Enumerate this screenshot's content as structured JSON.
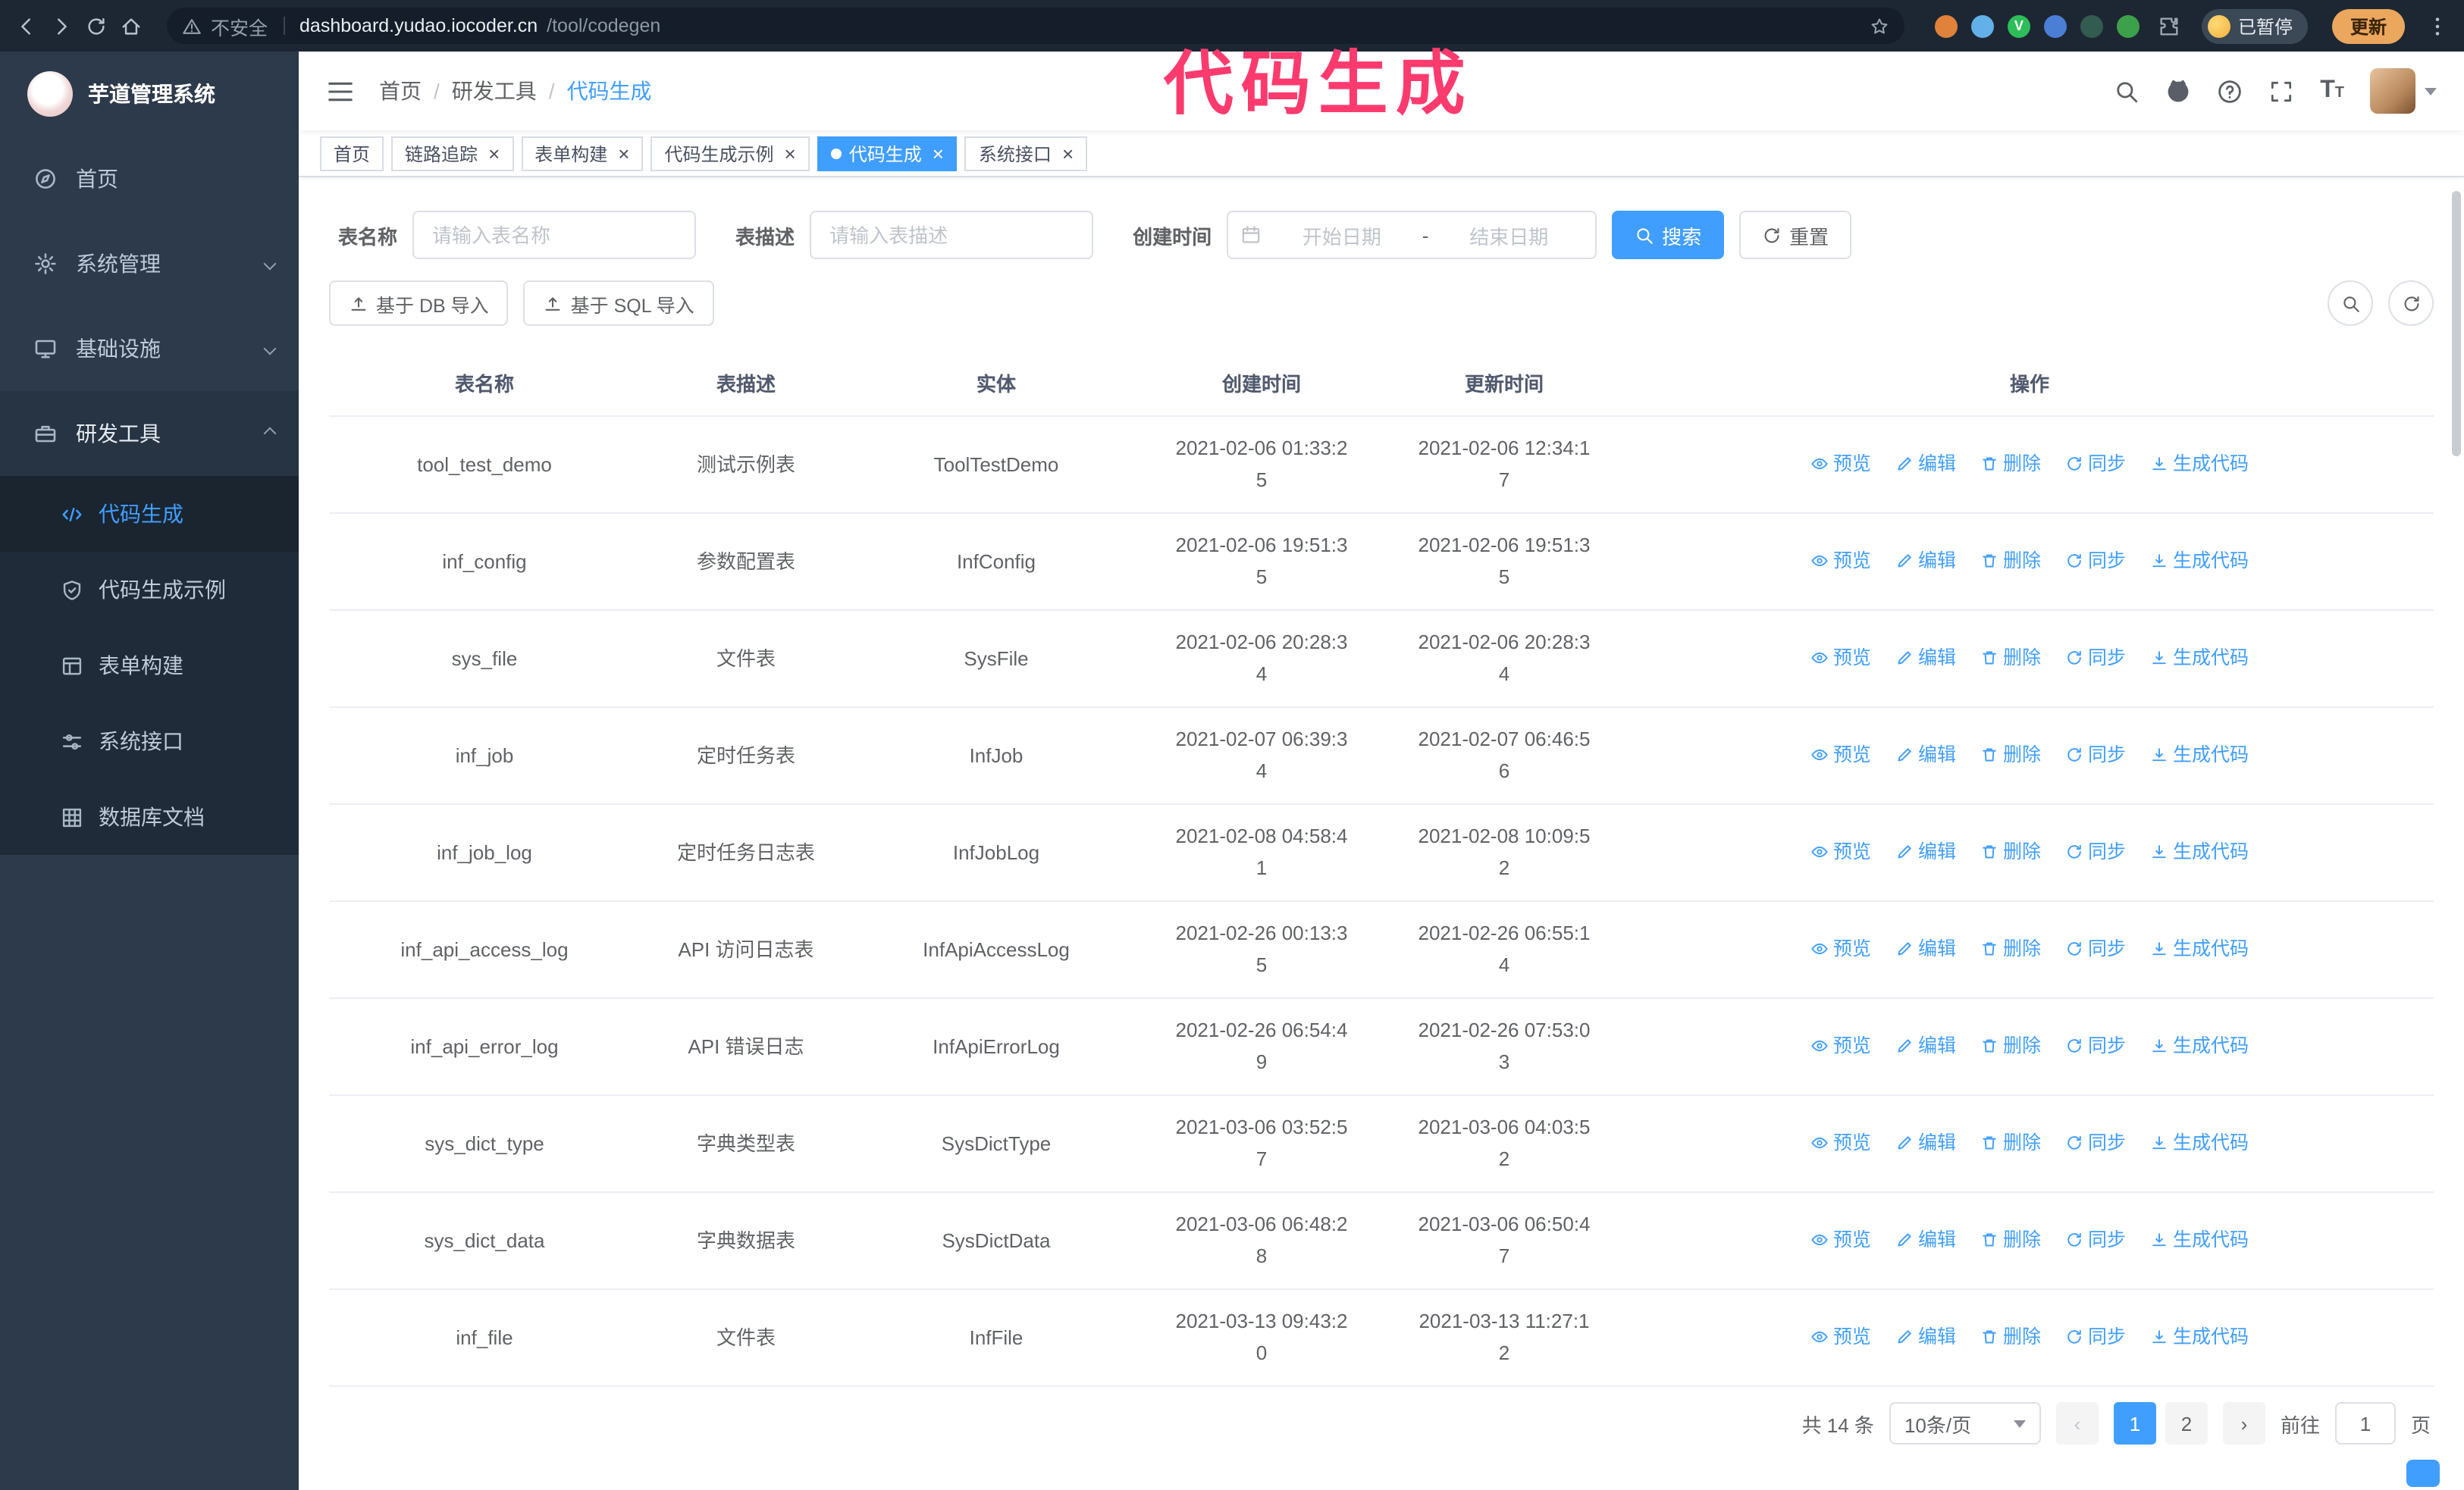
{
  "colors": {
    "accent": "#409eff",
    "annotation_pink": "#fb3b6e",
    "sidebar_bg": "#2d3a4b",
    "submenu_bg": "#1f2b38",
    "chrome_bg": "#1d2733",
    "update_button_bg": "#eba75d"
  },
  "annotation_text": "代码生成",
  "browser": {
    "security_text": "不安全",
    "url_host": "dashboard.yudao.iocoder.cn",
    "url_path": "/tool/codegen",
    "profile_badge": "已暂停",
    "update_button": "更新",
    "extension_colors": [
      "#e0823a",
      "#62b0e8",
      "#2ebd59",
      "#4b7fd6",
      "#315c4f",
      "#3da04a"
    ],
    "extension_glyph": "V"
  },
  "sidebar": {
    "logo_title": "芋道管理系统",
    "items": [
      {
        "label": "首页",
        "icon": "compass"
      },
      {
        "label": "系统管理",
        "icon": "gear",
        "chevron": "down"
      },
      {
        "label": "基础设施",
        "icon": "monitor",
        "chevron": "down"
      },
      {
        "label": "研发工具",
        "icon": "toolbox",
        "chevron": "up",
        "expanded": true
      }
    ],
    "sub_items": [
      {
        "label": "代码生成",
        "icon": "code",
        "active": true
      },
      {
        "label": "代码生成示例",
        "icon": "shield"
      },
      {
        "label": "表单构建",
        "icon": "form"
      },
      {
        "label": "系统接口",
        "icon": "sliders"
      },
      {
        "label": "数据库文档",
        "icon": "grid"
      }
    ]
  },
  "header": {
    "breadcrumb": [
      "首页",
      "研发工具",
      "代码生成"
    ]
  },
  "tabs": [
    {
      "label": "首页",
      "closable": false,
      "active": false
    },
    {
      "label": "链路追踪",
      "closable": true,
      "active": false
    },
    {
      "label": "表单构建",
      "closable": true,
      "active": false
    },
    {
      "label": "代码生成示例",
      "closable": true,
      "active": false
    },
    {
      "label": "代码生成",
      "closable": true,
      "active": true
    },
    {
      "label": "系统接口",
      "closable": true,
      "active": false
    }
  ],
  "filters": {
    "table_name_label": "表名称",
    "table_name_placeholder": "请输入表名称",
    "table_desc_label": "表描述",
    "table_desc_placeholder": "请输入表描述",
    "create_time_label": "创建时间",
    "date_start_placeholder": "开始日期",
    "date_separator": "-",
    "date_end_placeholder": "结束日期",
    "search_button": "搜索",
    "reset_button": "重置"
  },
  "toolbar": {
    "import_db": "基于 DB 导入",
    "import_sql": "基于 SQL 导入"
  },
  "table": {
    "columns": [
      "表名称",
      "表描述",
      "实体",
      "创建时间",
      "更新时间",
      "操作"
    ],
    "actions": [
      {
        "label": "预览",
        "icon": "eye"
      },
      {
        "label": "编辑",
        "icon": "edit"
      },
      {
        "label": "删除",
        "icon": "trash"
      },
      {
        "label": "同步",
        "icon": "sync"
      },
      {
        "label": "生成代码",
        "icon": "download"
      }
    ],
    "rows": [
      {
        "name": "tool_test_demo",
        "desc": "测试示例表",
        "entity": "ToolTestDemo",
        "created": "2021-02-06 01:33:25",
        "updated": "2021-02-06 12:34:17"
      },
      {
        "name": "inf_config",
        "desc": "参数配置表",
        "entity": "InfConfig",
        "created": "2021-02-06 19:51:35",
        "updated": "2021-02-06 19:51:35"
      },
      {
        "name": "sys_file",
        "desc": "文件表",
        "entity": "SysFile",
        "created": "2021-02-06 20:28:34",
        "updated": "2021-02-06 20:28:34"
      },
      {
        "name": "inf_job",
        "desc": "定时任务表",
        "entity": "InfJob",
        "created": "2021-02-07 06:39:34",
        "updated": "2021-02-07 06:46:56"
      },
      {
        "name": "inf_job_log",
        "desc": "定时任务日志表",
        "entity": "InfJobLog",
        "created": "2021-02-08 04:58:41",
        "updated": "2021-02-08 10:09:52"
      },
      {
        "name": "inf_api_access_log",
        "desc": "API 访问日志表",
        "entity": "InfApiAccessLog",
        "created": "2021-02-26 00:13:35",
        "updated": "2021-02-26 06:55:14"
      },
      {
        "name": "inf_api_error_log",
        "desc": "API 错误日志",
        "entity": "InfApiErrorLog",
        "created": "2021-02-26 06:54:49",
        "updated": "2021-02-26 07:53:03"
      },
      {
        "name": "sys_dict_type",
        "desc": "字典类型表",
        "entity": "SysDictType",
        "created": "2021-03-06 03:52:57",
        "updated": "2021-03-06 04:03:52"
      },
      {
        "name": "sys_dict_data",
        "desc": "字典数据表",
        "entity": "SysDictData",
        "created": "2021-03-06 06:48:28",
        "updated": "2021-03-06 06:50:47"
      },
      {
        "name": "inf_file",
        "desc": "文件表",
        "entity": "InfFile",
        "created": "2021-03-13 09:43:20",
        "updated": "2021-03-13 11:27:12"
      }
    ]
  },
  "pagination": {
    "total": "共 14 条",
    "page_size": "10条/页",
    "prev": "‹",
    "next": "›",
    "pages": [
      "1",
      "2"
    ],
    "current": "1",
    "goto_label": "前往",
    "goto_value": "1",
    "goto_unit": "页"
  }
}
